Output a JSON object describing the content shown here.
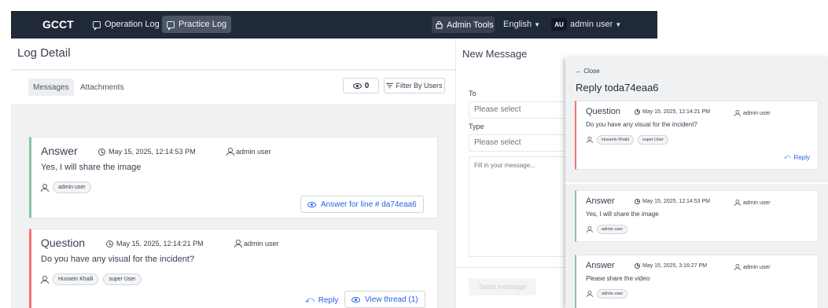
{
  "navbar": {
    "brand": "GCCT",
    "operation_log": "Operation Log",
    "practice_log": "Practice Log",
    "admin_tools": "Admin Tools",
    "language": "English",
    "avatar_initials": "AU",
    "user_name": "admin user"
  },
  "log": {
    "title": "Log Detail",
    "tabs": [
      "Messages",
      "Attachments"
    ],
    "viewer_count": "0",
    "filter_label": "Filter By Users",
    "cards": [
      {
        "type": "Answer",
        "date": "May 15, 2025, 12:14:53 PM",
        "author": "admin user",
        "body": "Yes, I will share the image",
        "tags": [
          "admin user"
        ],
        "action": "Answer for line # da74eaa6"
      },
      {
        "type": "Question",
        "date": "May 15, 2025, 12:14:21 PM",
        "author": "admin user",
        "body": "Do you have any visual for the incident?",
        "tags": [
          "Hussein Khalil",
          "super User"
        ],
        "reply": "Reply",
        "view_thread": "View thread (1)"
      }
    ]
  },
  "new_message": {
    "title": "New Message",
    "to_label": "To",
    "to_placeholder": "Please select",
    "type_label": "Type",
    "type_placeholder": "Please select",
    "message_placeholder": "Fill in your message...",
    "send_label": "Send message"
  },
  "thread": {
    "close_label": "← Close",
    "title": "Reply toda74eaa6",
    "cards": [
      {
        "type": "Question",
        "date": "May 15, 2025, 12:14:21 PM",
        "author": "admin user",
        "body": "Do you have any visual for the incident?",
        "tags": [
          "Hussein Khalil",
          "super User"
        ],
        "reply": "Reply"
      },
      {
        "type": "Answer",
        "date": "May 15, 2025, 12:14:53 PM",
        "author": "admin user",
        "body": "Yes, I will share the image",
        "tags": [
          "admin user"
        ]
      },
      {
        "type": "Answer",
        "date": "May 15, 2025, 3:16:27 PM",
        "author": "admin user",
        "body": "Please share the video",
        "tags": [
          "admin user"
        ]
      }
    ]
  },
  "colors": {
    "navbar": "#1f2937",
    "accent_link": "#2563eb",
    "answer_border": "#86c6a2",
    "question_border": "#f87171"
  }
}
